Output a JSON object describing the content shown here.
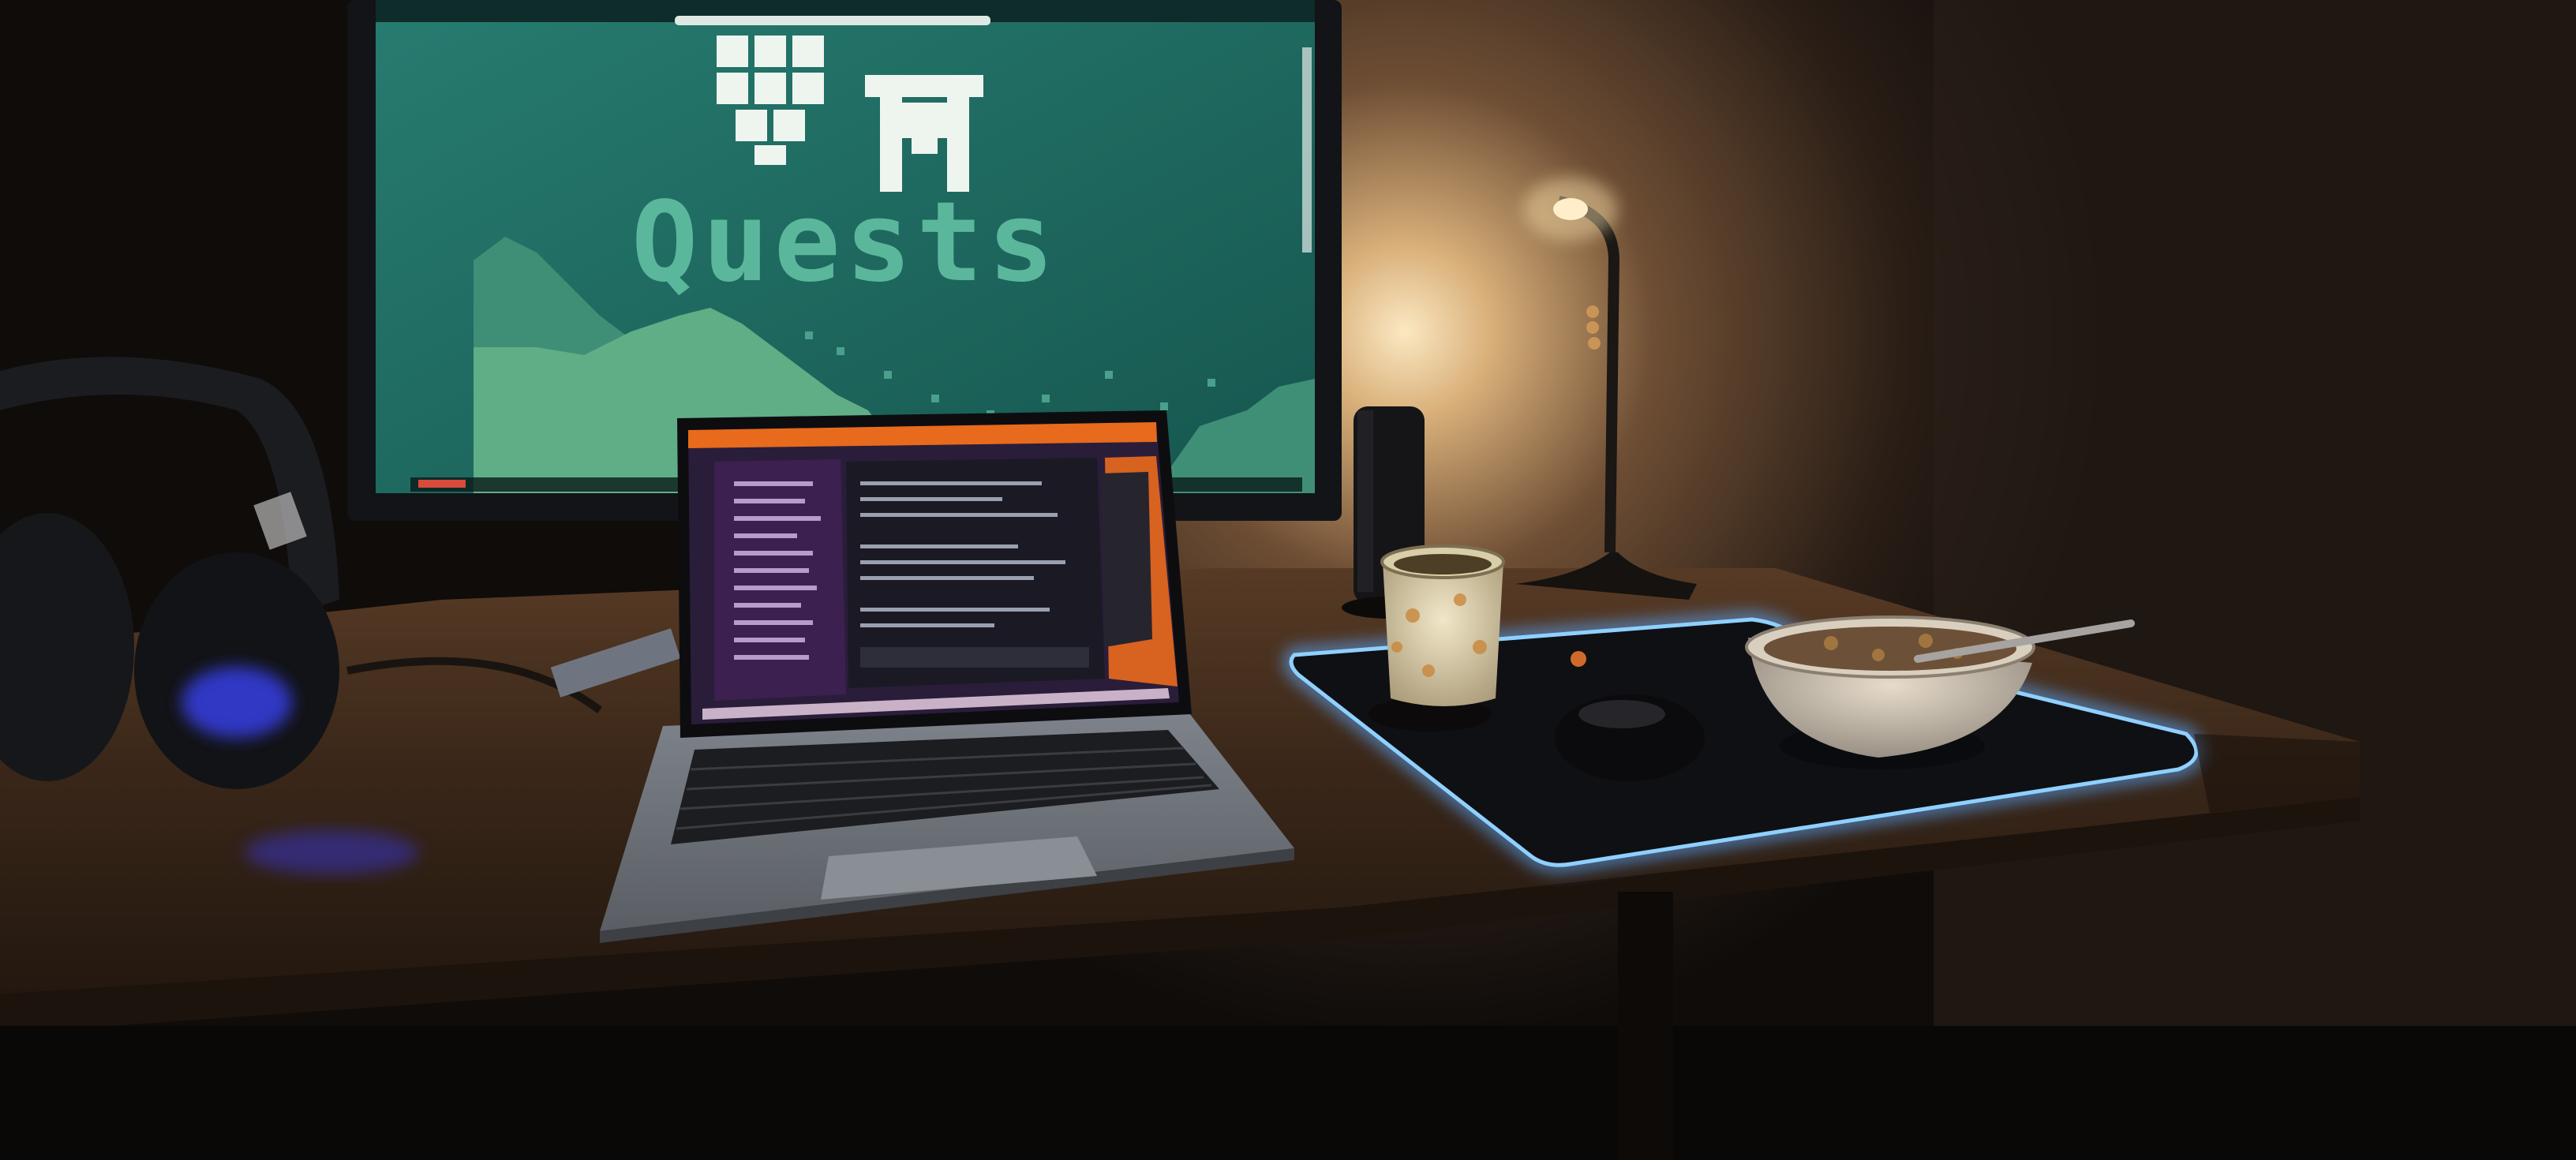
{
  "monitor": {
    "title": "Quests"
  },
  "colors": {
    "wall_dark": "#120e0b",
    "wall_lit": "#f4d9a8",
    "desk": "#3a2618",
    "monitor_bg": "#1d6e66",
    "monitor_hill": "#4fa37a",
    "pixel_text": "#5bb79b",
    "laptop_screen_bg": "#2a1d3a",
    "laptop_accent": "#e86a1c",
    "mousepad_glow": "#5aa8ff",
    "headset_glow": "#3a44ff"
  },
  "icons": {
    "logo_left": "pixel-block-logo-icon",
    "logo_right": "pixel-gate-logo-icon"
  }
}
